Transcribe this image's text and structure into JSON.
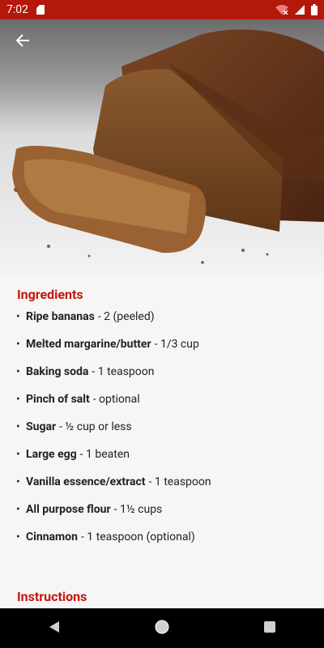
{
  "status_bar": {
    "time": "7:02",
    "icons": [
      "sd-card-icon",
      "wifi-off-icon",
      "signal-icon",
      "battery-icon"
    ]
  },
  "header": {
    "back_icon": "arrow-back-icon",
    "image_desc": "banana-bread-loaf-photo"
  },
  "ingredients": {
    "title": "Ingredients",
    "items": [
      {
        "name": "Ripe bananas",
        "desc": "- 2 (peeled)"
      },
      {
        "name": "Melted margarine/butter",
        "desc": "- 1/3 cup"
      },
      {
        "name": "Baking soda",
        "desc": "- 1 teaspoon"
      },
      {
        "name": "Pinch of salt",
        "desc": "- optional"
      },
      {
        "name": "Sugar",
        "desc": "- ½ cup or less"
      },
      {
        "name": "Large egg",
        "desc": "- 1 beaten"
      },
      {
        "name": "Vanilla essence/extract",
        "desc": "- 1 teaspoon"
      },
      {
        "name": "All purpose flour",
        "desc": "- 1½ cups"
      },
      {
        "name": "Cinnamon",
        "desc": "- 1 teaspoon (optional)"
      }
    ]
  },
  "instructions": {
    "title": "Instructions"
  },
  "colors": {
    "accent": "#c4160d",
    "status_bar": "#b3180b"
  }
}
